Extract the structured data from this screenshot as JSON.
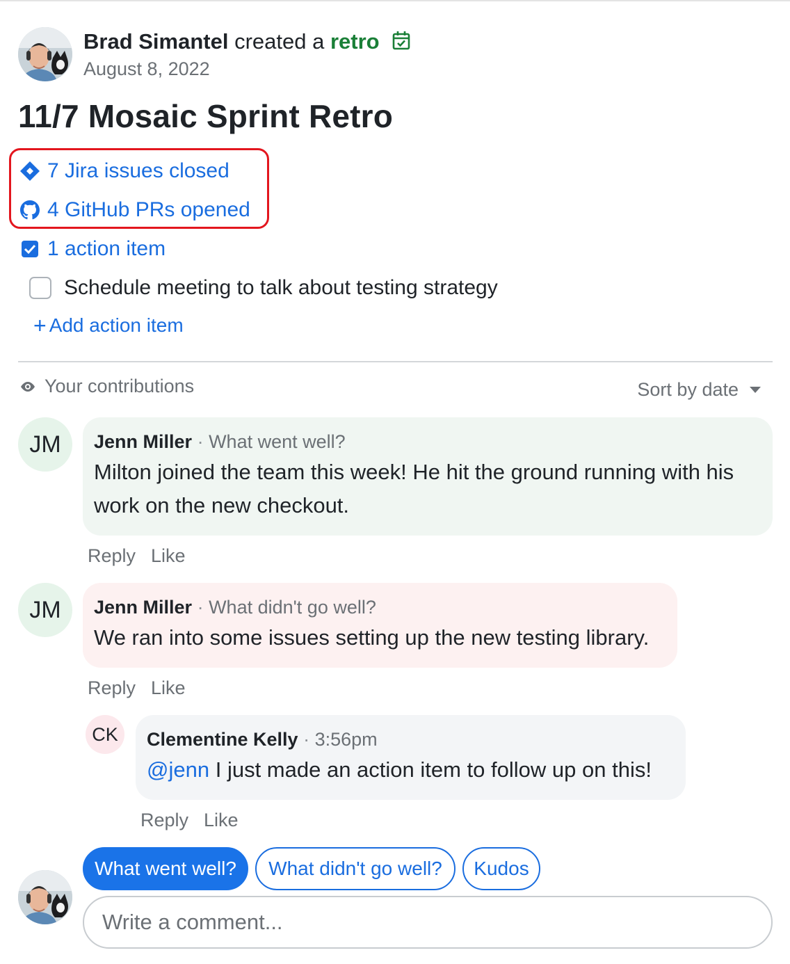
{
  "post": {
    "author": "Brad Simantel",
    "verb": "created a",
    "type_word": "retro",
    "date": "August 8, 2022",
    "title": "11/7 Mosaic Sprint Retro"
  },
  "stats": {
    "jira": "7 Jira issues closed",
    "github": "4 GitHub PRs opened",
    "action_items": "1 action item"
  },
  "todo": {
    "text": "Schedule meeting to talk about testing strategy",
    "checked": false
  },
  "add_action_label": "Add action item",
  "contributions_label": "Your contributions",
  "sort_label": "Sort by date",
  "comments": [
    {
      "initials": "JM",
      "author": "Jenn Miller",
      "category": "What went well?",
      "text": "Milton joined the team this week! He hit the ground running with his work on the new checkout.",
      "bubble_color": "#f0f6f2"
    },
    {
      "initials": "JM",
      "author": "Jenn Miller",
      "category": "What didn't go well?",
      "text": "We ran into some issues setting up the new testing library.",
      "bubble_color": "#fdf1f1"
    }
  ],
  "reply": {
    "initials": "CK",
    "author": "Clementine Kelly",
    "time": "3:56pm",
    "mention": "@jenn",
    "text": "I just made an action item to follow up on this!",
    "bubble_color": "#f3f5f7"
  },
  "action_labels": {
    "reply": "Reply",
    "like": "Like"
  },
  "separator": "·",
  "chips": [
    "What went well?",
    "What didn't go well?",
    "Kudos"
  ],
  "active_chip": "What went well?",
  "comment_placeholder": "Write a comment...",
  "colors": {
    "link_blue": "#1a6ddf",
    "primary_blue": "#1a73e8",
    "retro_green": "#1a7f37",
    "highlight_red": "#e3161e",
    "jm_avatar_bg": "#e6f4ea",
    "ck_avatar_bg": "#fce8ec"
  },
  "icons": {
    "jira": "jira-diamond-icon",
    "github": "github-icon",
    "action": "checked-checkbox-icon",
    "calendar": "calendar-check-icon",
    "eye": "eye-icon",
    "sort": "caret-down-icon"
  }
}
